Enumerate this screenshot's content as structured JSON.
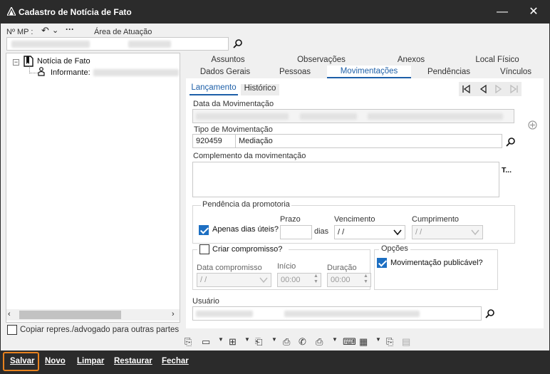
{
  "window": {
    "title": "Cadastro de Notícia de Fato",
    "minimize_glyph": "—",
    "close_glyph": "✕"
  },
  "header": {
    "mp_label": "Nº MP :",
    "area_label": "Área de Atuação"
  },
  "tree": {
    "root_label": "Notícia de Fato",
    "child_label": "Informante:",
    "copy_checkbox_label": "Copiar repres./advogado para outras partes"
  },
  "tabs": {
    "row1": [
      "Assuntos",
      "Observações",
      "Anexos",
      "Local Físico"
    ],
    "row2": [
      "Dados Gerais",
      "Pessoas",
      "Movimentações",
      "Pendências",
      "Vínculos"
    ],
    "active": "Movimentações"
  },
  "subtabs": {
    "items": [
      "Lançamento",
      "Histórico"
    ],
    "active": "Lançamento"
  },
  "form": {
    "data_mov_label": "Data da Movimentação",
    "tipo_mov_label": "Tipo de Movimentação",
    "tipo_code": "920459",
    "tipo_desc": "Mediação",
    "complemento_label": "Complemento da movimentação",
    "complemento_side_btn": "T...",
    "pendencia_group": "Pendência da promotoria",
    "prazo_label": "Prazo",
    "apenas_dias_uteis": "Apenas dias úteis?",
    "dias_label": "dias",
    "vencimento_label": "Vencimento",
    "vencimento_value": " /  /",
    "cumprimento_label": "Cumprimento",
    "cumprimento_value": " /  /",
    "criar_compromisso": "Criar compromisso?",
    "data_compromisso_label": "Data compromisso",
    "data_compromisso_value": " /  /",
    "inicio_label": "Início",
    "inicio_value": "00:00",
    "duracao_label": "Duração",
    "duracao_value": "00:00",
    "opcoes_group": "Opções",
    "movimentacao_publicavel": "Movimentação publicável?",
    "usuario_label": "Usuário"
  },
  "bottom": {
    "salvar": "Salvar",
    "novo": "Novo",
    "limpar": "Limpar",
    "restaurar": "Restaurar",
    "fechar": "Fechar"
  },
  "colors": {
    "accent": "#1d5fa8",
    "dark": "#2b2b2b",
    "highlight": "#e8821e"
  }
}
